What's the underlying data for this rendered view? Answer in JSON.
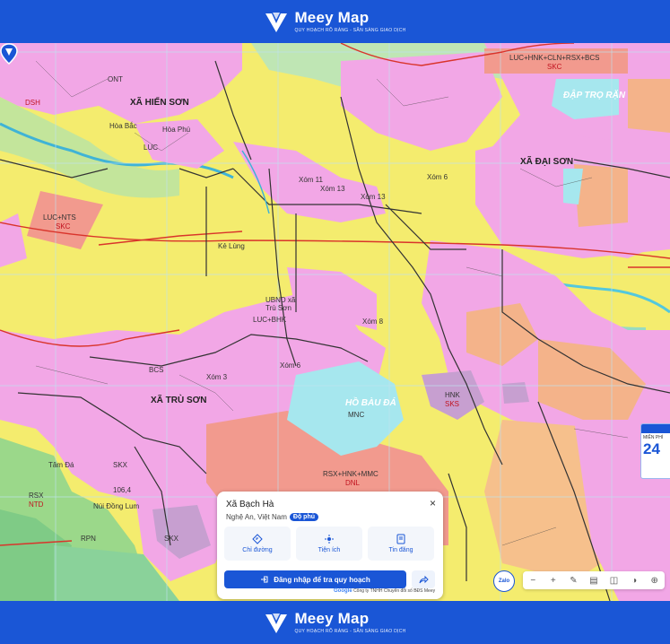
{
  "brand": {
    "name": "Meey Map",
    "tagline": "QUY HOẠCH RÕ RÀNG - SẴN SÀNG GIAO DỊCH"
  },
  "map": {
    "place_labels": {
      "xa_hien_son": "XÃ HIẾN SƠN",
      "xa_dai_son": "XÃ ĐẠI SƠN",
      "xa_tru_son": "XÃ TRÙ SƠN",
      "hoa_bac": "Hòa Bắc",
      "hoa_phu": "Hòa Phú",
      "ke_lung": "Kẻ Lùng",
      "xom_13a": "Xóm 13",
      "xom_13b": "Xóm 13",
      "xom_11": "Xóm 11",
      "xom_6a": "Xóm 6",
      "xom_6b": "Xóm 6",
      "xom_8": "Xóm 8",
      "xom_3": "Xóm 3",
      "ubnd": "UBND xã Trù Sơn",
      "ho_bau_da": "HỒ BÀU ĐÁ",
      "dap_tro_ran": "ĐẬP TRỌ RẶN",
      "tam_da": "Tâm Đá",
      "nui_dong_lum": "Núi Đồng Lum",
      "peak": "106,4"
    },
    "codes": {
      "luc_nts": "LUC+NTS",
      "skc_1": "SKC",
      "luc_hnk": "LUC+HNK+CLN+RSX+BCS",
      "skc_2": "SKC",
      "rsx_hnk_mmc": "RSX+HNK+MMC",
      "dnl": "DNL",
      "mnc": "MNC",
      "hnk_sks": "HNK",
      "sks": "SKS",
      "luc_main": "LUC",
      "ont_main": "ONT",
      "luc_bhk": "LUC+BHK",
      "bcs": "BCS",
      "dsh": "DSH",
      "skx_1": "SKX",
      "skx_2": "SKX",
      "rpn": "RPN",
      "rsx_ntd": "RSX",
      "ntd": "NTD"
    },
    "pin_icon": "location-pin-icon"
  },
  "panel": {
    "title": "Xã Bạch Hà",
    "location": "Nghệ An, Việt Nam",
    "badge": "Độ phủ",
    "actions": [
      {
        "label": "Chỉ đường",
        "icon": "directions-icon"
      },
      {
        "label": "Tiện ích",
        "icon": "amenities-icon"
      },
      {
        "label": "Tin đăng",
        "icon": "listings-icon"
      }
    ],
    "login_label": "Đăng nhập để tra quy hoạch",
    "close_symbol": "×"
  },
  "attribution": {
    "google": "Google",
    "text": "Công ty TNHH Chuyển đổi số BĐS Meey"
  },
  "toolbar": {
    "zalo": "Zalo",
    "minus": "−",
    "plus": "+"
  },
  "side_ad": {
    "text": "MIỄN PHÍ",
    "number": "24"
  },
  "colors": {
    "brand_blue": "#1a56d6",
    "agri_yellow": "#f4ec6e",
    "residential_pink": "#f2a7e6",
    "water_blue": "#a6e7ee",
    "industrial_salmon": "#f29a8e",
    "forest_green": "#9bd88a"
  }
}
